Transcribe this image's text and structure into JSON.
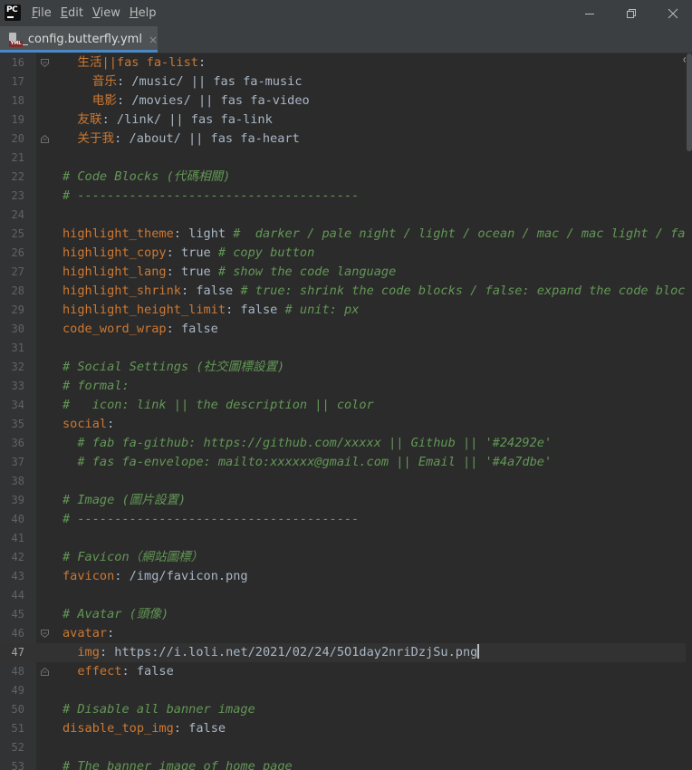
{
  "titlebar": {
    "logo_text": "PC",
    "menus": [
      {
        "mnemonic": "F",
        "rest": "ile"
      },
      {
        "mnemonic": "E",
        "rest": "dit"
      },
      {
        "mnemonic": "V",
        "rest": "iew"
      },
      {
        "mnemonic": "H",
        "rest": "elp"
      }
    ]
  },
  "tab": {
    "icon_label": "YML",
    "label": "_config.butterfly.yml",
    "close": "×"
  },
  "editor": {
    "caret_line": "47",
    "lines": [
      {
        "n": "16",
        "indent": "  ",
        "k": "生活||fas fa-list",
        "sep": ":",
        "v": "",
        "c": ""
      },
      {
        "n": "17",
        "indent": "    ",
        "k": "音乐",
        "sep": ":",
        "v": " /music/ || fas fa-music",
        "c": ""
      },
      {
        "n": "18",
        "indent": "    ",
        "k": "电影",
        "sep": ":",
        "v": " /movies/ || fas fa-video",
        "c": ""
      },
      {
        "n": "19",
        "indent": "  ",
        "k": "友联",
        "sep": ":",
        "v": " /link/ || fas fa-link",
        "c": ""
      },
      {
        "n": "20",
        "indent": "  ",
        "k": "关于我",
        "sep": ":",
        "v": " /about/ || fas fa-heart",
        "c": ""
      },
      {
        "n": "21",
        "indent": "",
        "k": "",
        "sep": "",
        "v": "",
        "c": ""
      },
      {
        "n": "22",
        "indent": "",
        "k": "",
        "sep": "",
        "v": "",
        "c": "# Code Blocks (代碼相關)"
      },
      {
        "n": "23",
        "indent": "",
        "k": "",
        "sep": "",
        "v": "",
        "c": "# --------------------------------------"
      },
      {
        "n": "24",
        "indent": "",
        "k": "",
        "sep": "",
        "v": "",
        "c": ""
      },
      {
        "n": "25",
        "indent": "",
        "k": "highlight_theme",
        "sep": ":",
        "v": " light ",
        "c": "#  darker / pale night / light / ocean / mac / mac light / false"
      },
      {
        "n": "26",
        "indent": "",
        "k": "highlight_copy",
        "sep": ":",
        "v": " true ",
        "c": "# copy button"
      },
      {
        "n": "27",
        "indent": "",
        "k": "highlight_lang",
        "sep": ":",
        "v": " true ",
        "c": "# show the code language"
      },
      {
        "n": "28",
        "indent": "",
        "k": "highlight_shrink",
        "sep": ":",
        "v": " false ",
        "c": "# true: shrink the code blocks / false: expand the code blocks"
      },
      {
        "n": "29",
        "indent": "",
        "k": "highlight_height_limit",
        "sep": ":",
        "v": " false ",
        "c": "# unit: px"
      },
      {
        "n": "30",
        "indent": "",
        "k": "code_word_wrap",
        "sep": ":",
        "v": " false",
        "c": ""
      },
      {
        "n": "31",
        "indent": "",
        "k": "",
        "sep": "",
        "v": "",
        "c": ""
      },
      {
        "n": "32",
        "indent": "",
        "k": "",
        "sep": "",
        "v": "",
        "c": "# Social Settings (社交圖標設置)"
      },
      {
        "n": "33",
        "indent": "",
        "k": "",
        "sep": "",
        "v": "",
        "c": "# formal:"
      },
      {
        "n": "34",
        "indent": "",
        "k": "",
        "sep": "",
        "v": "",
        "c": "#   icon: link || the description || color"
      },
      {
        "n": "35",
        "indent": "",
        "k": "social",
        "sep": ":",
        "v": "",
        "c": ""
      },
      {
        "n": "36",
        "indent": "  ",
        "k": "",
        "sep": "",
        "v": "",
        "c": "# fab fa-github: https://github.com/xxxxx || Github || '#24292e'"
      },
      {
        "n": "37",
        "indent": "  ",
        "k": "",
        "sep": "",
        "v": "",
        "c": "# fas fa-envelope: mailto:xxxxxx@gmail.com || Email || '#4a7dbe'"
      },
      {
        "n": "38",
        "indent": "",
        "k": "",
        "sep": "",
        "v": "",
        "c": ""
      },
      {
        "n": "39",
        "indent": "",
        "k": "",
        "sep": "",
        "v": "",
        "c": "# Image (圖片設置)"
      },
      {
        "n": "40",
        "indent": "",
        "k": "",
        "sep": "",
        "v": "",
        "c": "# --------------------------------------"
      },
      {
        "n": "41",
        "indent": "",
        "k": "",
        "sep": "",
        "v": "",
        "c": ""
      },
      {
        "n": "42",
        "indent": "",
        "k": "",
        "sep": "",
        "v": "",
        "c": "# Favicon（網站圖標）"
      },
      {
        "n": "43",
        "indent": "",
        "k": "favicon",
        "sep": ":",
        "v": " /img/favicon.png",
        "c": ""
      },
      {
        "n": "44",
        "indent": "",
        "k": "",
        "sep": "",
        "v": "",
        "c": ""
      },
      {
        "n": "45",
        "indent": "",
        "k": "",
        "sep": "",
        "v": "",
        "c": "# Avatar (頭像)"
      },
      {
        "n": "46",
        "indent": "",
        "k": "avatar",
        "sep": ":",
        "v": "",
        "c": ""
      },
      {
        "n": "47",
        "indent": "  ",
        "k": "img",
        "sep": ":",
        "v": " https://i.loli.net/2021/02/24/5O1day2nriDzjSu.png",
        "c": ""
      },
      {
        "n": "48",
        "indent": "  ",
        "k": "effect",
        "sep": ":",
        "v": " false",
        "c": ""
      },
      {
        "n": "49",
        "indent": "",
        "k": "",
        "sep": "",
        "v": "",
        "c": ""
      },
      {
        "n": "50",
        "indent": "",
        "k": "",
        "sep": "",
        "v": "",
        "c": "# Disable all banner image"
      },
      {
        "n": "51",
        "indent": "",
        "k": "disable_top_img",
        "sep": ":",
        "v": " false",
        "c": ""
      },
      {
        "n": "52",
        "indent": "",
        "k": "",
        "sep": "",
        "v": "",
        "c": ""
      },
      {
        "n": "53",
        "indent": "",
        "k": "",
        "sep": "",
        "v": "",
        "c": "# The banner image of home page"
      }
    ]
  },
  "colors": {
    "keyword": "#cc7832",
    "comment": "#629755",
    "text": "#a9b7c6",
    "background": "#2b2b2b",
    "accent": "#4a88c7"
  },
  "icons": {
    "logo": "pycharm-logo-icon",
    "minimize": "minimize-icon",
    "restore": "restore-icon",
    "close": "close-icon",
    "file": "yml-file-icon",
    "fold": "fold-marker-icon",
    "view": "eye-icon"
  }
}
